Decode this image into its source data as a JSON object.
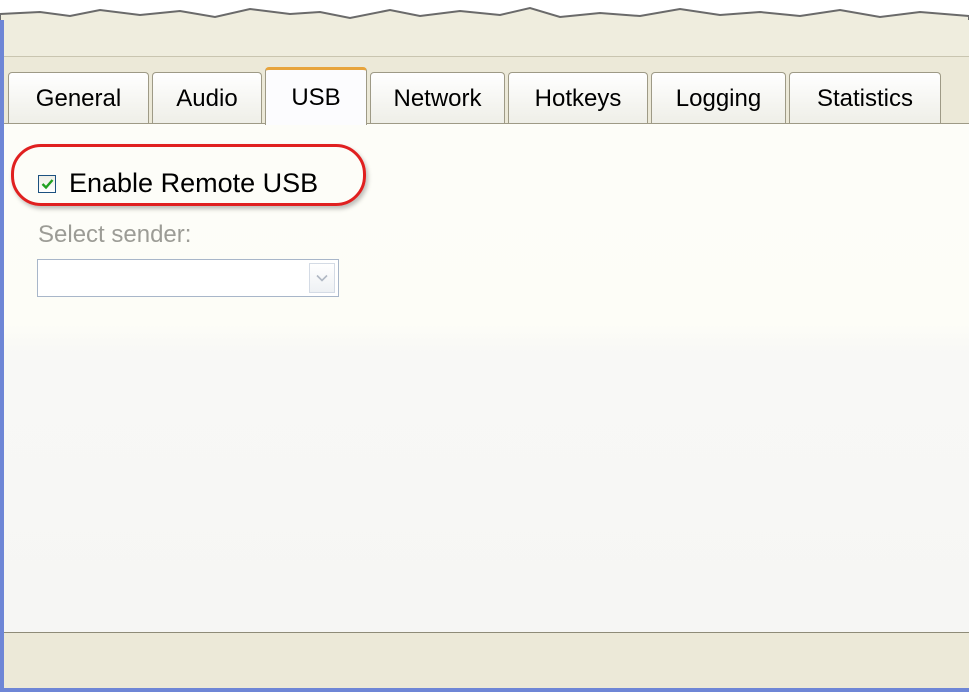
{
  "tabs": [
    {
      "label": "General"
    },
    {
      "label": "Audio"
    },
    {
      "label": "USB"
    },
    {
      "label": "Network"
    },
    {
      "label": "Hotkeys"
    },
    {
      "label": "Logging"
    },
    {
      "label": "Statistics"
    }
  ],
  "active_tab": "USB",
  "usb": {
    "enable_label": "Enable Remote USB",
    "enable_checked": true,
    "sender_label": "Select sender:",
    "sender_value": ""
  },
  "colors": {
    "highlight": "#e02020",
    "active_tab_accent": "#e7a43c",
    "check_mark": "#21a121",
    "window_border": "#6e86d6"
  },
  "icons": {
    "check": "check-icon",
    "dropdown": "chevron-down-icon"
  }
}
